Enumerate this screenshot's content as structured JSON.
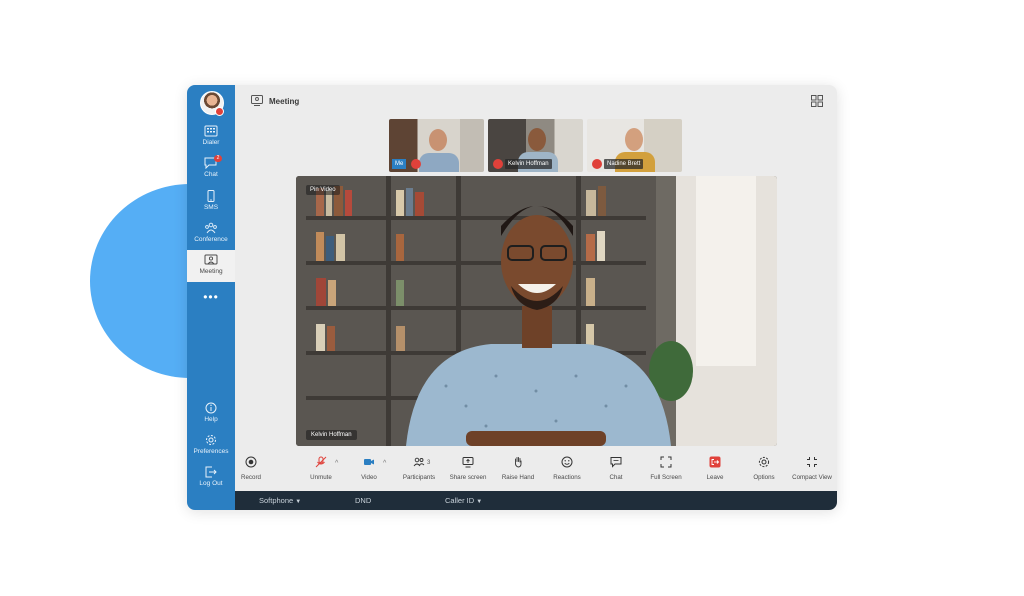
{
  "sidebar": {
    "items": [
      {
        "label": "Dialer",
        "icon": "dialer-icon"
      },
      {
        "label": "Chat",
        "icon": "chat-icon",
        "badge": "2"
      },
      {
        "label": "SMS",
        "icon": "sms-icon"
      },
      {
        "label": "Conference",
        "icon": "conference-icon"
      },
      {
        "label": "Meeting",
        "icon": "meeting-icon",
        "active": true
      }
    ],
    "more": "•••",
    "bottom_items": [
      {
        "label": "Help",
        "icon": "help-icon"
      },
      {
        "label": "Preferences",
        "icon": "gear-icon"
      },
      {
        "label": "Log Out",
        "icon": "logout-icon"
      }
    ]
  },
  "header": {
    "title": "Meeting"
  },
  "thumbnails": [
    {
      "tag": "Me",
      "name": ""
    },
    {
      "tag": "",
      "name": "Kelvin Hoffman"
    },
    {
      "tag": "",
      "name": "Nadine Brett"
    }
  ],
  "main_video": {
    "pin_label": "Pin Video",
    "speaker_name": "Kelvin Hoffman"
  },
  "toolbar": {
    "record": "Record",
    "unmute": "Unmute",
    "video": "Video",
    "participants": "Participants",
    "participants_count": "3",
    "share_screen": "Share screen",
    "raise_hand": "Raise Hand",
    "reactions": "Reactions",
    "chat": "Chat",
    "full_screen": "Full Screen",
    "leave": "Leave",
    "options": "Options",
    "compact_view": "Compact View"
  },
  "statusbar": {
    "softphone": "Softphone",
    "dnd": "DND",
    "caller_id": "Caller ID"
  },
  "colors": {
    "sidebar": "#2b7fc2",
    "accent_red": "#e0413a",
    "statusbar": "#1f2d3a",
    "blob": "#55aef5"
  }
}
